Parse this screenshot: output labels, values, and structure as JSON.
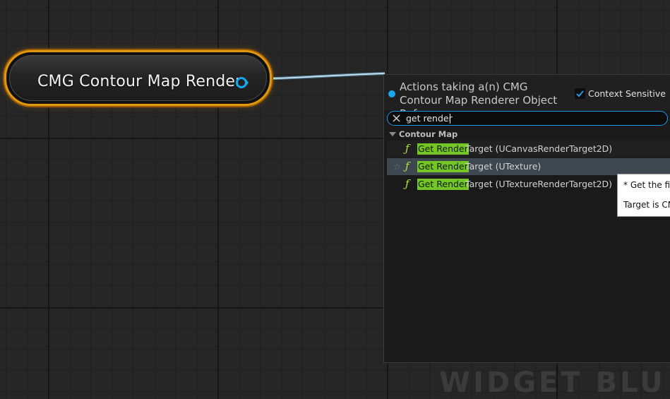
{
  "node": {
    "title": "CMG Contour Map Render",
    "accent_color": "#e0980e",
    "pin_color": "#19a8f0"
  },
  "menu": {
    "header_title": "Actions taking a(n) CMG Contour Map Renderer Object Reference",
    "context_sensitive": {
      "label": "Context Sensitive",
      "checked": true
    },
    "search": {
      "value": "get render",
      "clear_icon": "close-icon"
    },
    "category": {
      "label": "Contour Map"
    },
    "items": [
      {
        "icon": "function-icon",
        "highlight": "Get Render",
        "rest": "Target (UCanvasRenderTarget2D)"
      },
      {
        "icon": "function-icon",
        "highlight": "Get Render",
        "rest": "Target (UTexture)",
        "selected": true
      },
      {
        "icon": "function-icon",
        "highlight": "Get Render",
        "rest": "Target (UTextureRenderTarget2D)"
      }
    ],
    "highlight_color": "#74c627"
  },
  "tooltip": {
    "line1": "* Get the fina",
    "line2": "Target is CM"
  },
  "watermark": "WIDGET BLU"
}
